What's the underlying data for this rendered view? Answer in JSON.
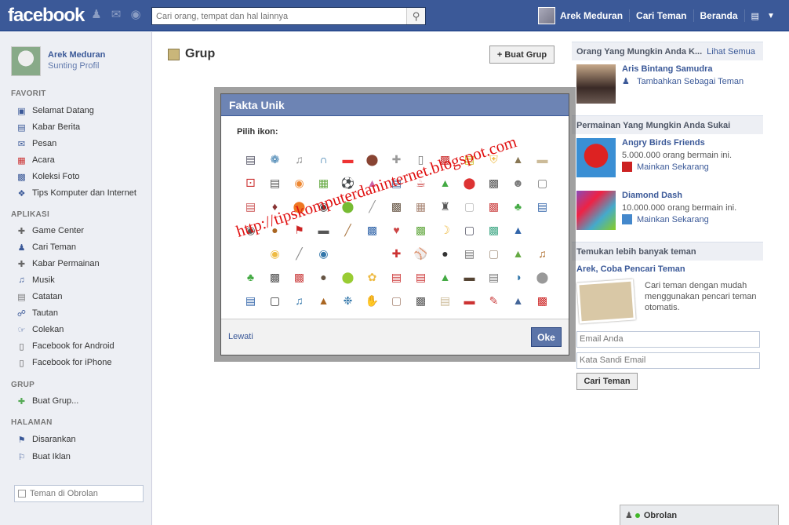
{
  "topbar": {
    "logo": "facebook",
    "search_placeholder": "Cari orang, tempat dan hal lainnya",
    "user_name": "Arek Meduran",
    "find_friends": "Cari Teman",
    "home": "Beranda"
  },
  "profile": {
    "name": "Arek Meduran",
    "edit": "Sunting Profil"
  },
  "sidebar": {
    "favorit_label": "FAVORIT",
    "favorit": [
      "Selamat Datang",
      "Kabar Berita",
      "Pesan",
      "Acara",
      "Koleksi Foto",
      "Tips Komputer dan Internet"
    ],
    "aplikasi_label": "APLIKASI",
    "aplikasi": [
      "Game Center",
      "Cari Teman",
      "Kabar Permainan",
      "Musik",
      "Catatan",
      "Tautan",
      "Colekan",
      "Facebook for Android",
      "Facebook for iPhone"
    ],
    "grup_label": "GRUP",
    "grup": [
      "Buat Grup..."
    ],
    "halaman_label": "HALAMAN",
    "halaman": [
      "Disarankan",
      "Buat Iklan"
    ],
    "chat_search": "Teman di Obrolan"
  },
  "main": {
    "title": "Grup",
    "create_group": "+ Buat Grup"
  },
  "right": {
    "pymk_title": "Orang Yang Mungkin Anda K...",
    "see_all": "Lihat Semua",
    "person_name": "Aris Bintang Samudra",
    "add_friend": "Tambahkan Sebagai Teman",
    "games_title": "Permainan Yang Mungkin Anda Sukai",
    "game1_name": "Angry Birds Friends",
    "game1_players": "5.000.000 orang bermain ini.",
    "game1_play": "Mainkan Sekarang",
    "game2_name": "Diamond Dash",
    "game2_players": "10.000.000 orang bermain ini.",
    "game2_play": "Mainkan Sekarang",
    "more_friends_title": "Temukan lebih banyak teman",
    "finder_title": "Arek, Coba Pencari Teman",
    "finder_desc": "Cari teman dengan mudah menggunakan pencari teman otomatis.",
    "email_placeholder": "Email Anda",
    "password_placeholder": "Kata Sandi Email",
    "find_button": "Cari Teman"
  },
  "chat": {
    "label": "Obrolan"
  },
  "modal": {
    "title": "Fakta Unik",
    "prompt": "Pilih ikon:",
    "skip": "Lewati",
    "ok": "Oke"
  },
  "watermark": "http://tipskomputerdaninternet.blogspot.com"
}
